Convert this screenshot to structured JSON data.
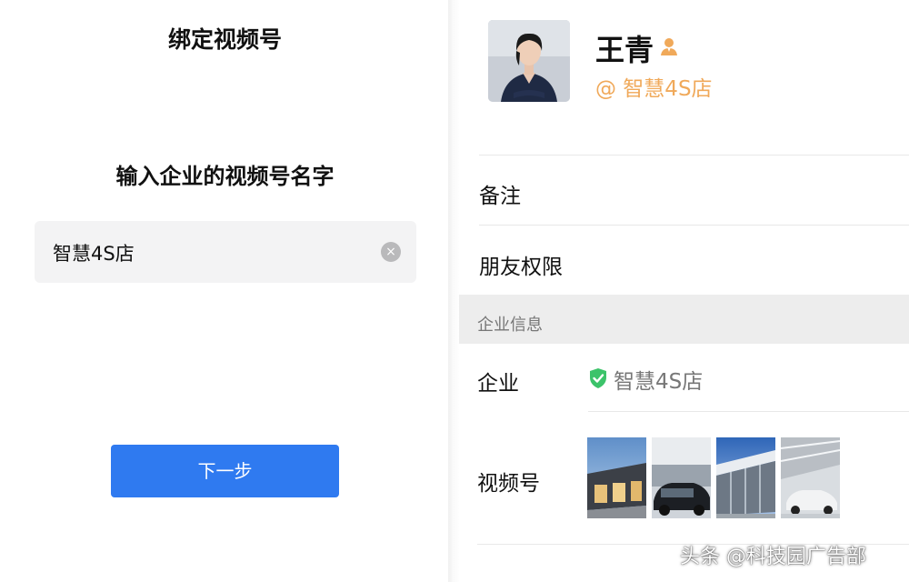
{
  "left": {
    "title": "绑定视频号",
    "prompt": "输入企业的视频号名字",
    "input_value": "智慧4S店",
    "clear_symbol": "×",
    "next_button": "下一步"
  },
  "right": {
    "contact_name": "王青",
    "company_handle": "@ 智慧4S店",
    "rows": {
      "remark": "备注",
      "friend_permissions": "朋友权限"
    },
    "section_title": "企业信息",
    "company_label": "企业",
    "company_value": "智慧4S店",
    "channels_label": "视频号",
    "thumbnails": [
      "showroom-exterior",
      "car-interior-lot",
      "glass-showroom",
      "indoor-showroom"
    ]
  },
  "watermark": "头条 @科技园广告部",
  "colors": {
    "accent_blue": "#2f7af0",
    "handle_orange": "#f0a95a",
    "verified_green": "#3cc36a",
    "section_bg": "#ededed",
    "input_bg": "#f3f3f4"
  }
}
